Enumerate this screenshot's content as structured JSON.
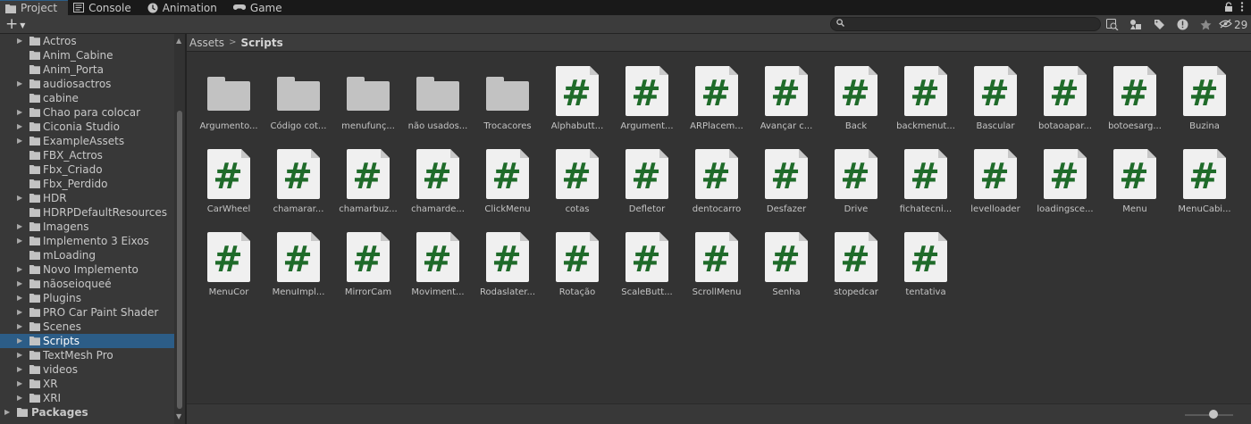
{
  "tabs": [
    {
      "label": "Project",
      "icon": "folder-icon",
      "active": true
    },
    {
      "label": "Console",
      "icon": "console-icon",
      "active": false
    },
    {
      "label": "Animation",
      "icon": "animation-icon",
      "active": false
    },
    {
      "label": "Game",
      "icon": "game-icon",
      "active": false
    }
  ],
  "toolbar": {
    "add_label": "+",
    "search_value": "",
    "search_placeholder": "",
    "hidden_count": "29"
  },
  "tree": {
    "items": [
      {
        "label": "Actros",
        "expandable": true
      },
      {
        "label": "Anim_Cabine",
        "expandable": false
      },
      {
        "label": "Anim_Porta",
        "expandable": false
      },
      {
        "label": "audiosactros",
        "expandable": true
      },
      {
        "label": "cabine",
        "expandable": false
      },
      {
        "label": "Chao para colocar",
        "expandable": true
      },
      {
        "label": "Ciconia Studio",
        "expandable": true
      },
      {
        "label": "ExampleAssets",
        "expandable": true
      },
      {
        "label": "FBX_Actros",
        "expandable": false
      },
      {
        "label": "Fbx_Criado",
        "expandable": false
      },
      {
        "label": "Fbx_Perdido",
        "expandable": false
      },
      {
        "label": "HDR",
        "expandable": true
      },
      {
        "label": "HDRPDefaultResources",
        "expandable": false
      },
      {
        "label": "Imagens",
        "expandable": true
      },
      {
        "label": "Implemento 3 Eixos",
        "expandable": true
      },
      {
        "label": "mLoading",
        "expandable": false
      },
      {
        "label": "Novo Implemento",
        "expandable": true
      },
      {
        "label": "nãoseioqueé",
        "expandable": true
      },
      {
        "label": "Plugins",
        "expandable": true
      },
      {
        "label": "PRO Car Paint Shader",
        "expandable": true
      },
      {
        "label": "Scenes",
        "expandable": true
      },
      {
        "label": "Scripts",
        "expandable": true,
        "selected": true
      },
      {
        "label": "TextMesh Pro",
        "expandable": true
      },
      {
        "label": "videos",
        "expandable": true
      },
      {
        "label": "XR",
        "expandable": true
      },
      {
        "label": "XRI",
        "expandable": true
      }
    ],
    "root": {
      "label": "Packages"
    }
  },
  "breadcrumb": {
    "root": "Assets",
    "current": "Scripts"
  },
  "assets": [
    {
      "name": "Argumento...",
      "type": "folder"
    },
    {
      "name": "Código cot...",
      "type": "folder"
    },
    {
      "name": "menufunç...",
      "type": "folder"
    },
    {
      "name": "não usados...",
      "type": "folder"
    },
    {
      "name": "Trocacores",
      "type": "folder"
    },
    {
      "name": "Alphabutt...",
      "type": "script"
    },
    {
      "name": "Argument...",
      "type": "script"
    },
    {
      "name": "ARPlacem...",
      "type": "script"
    },
    {
      "name": "Avançar c...",
      "type": "script"
    },
    {
      "name": "Back",
      "type": "script"
    },
    {
      "name": "backmenut...",
      "type": "script"
    },
    {
      "name": "Bascular",
      "type": "script"
    },
    {
      "name": "botaoapar...",
      "type": "script"
    },
    {
      "name": "botoesarg...",
      "type": "script"
    },
    {
      "name": "Buzina",
      "type": "script"
    },
    {
      "name": "CarWheel",
      "type": "script"
    },
    {
      "name": "chamarar...",
      "type": "script"
    },
    {
      "name": "chamarbuz...",
      "type": "script"
    },
    {
      "name": "chamarde...",
      "type": "script"
    },
    {
      "name": "ClickMenu",
      "type": "script"
    },
    {
      "name": "cotas",
      "type": "script"
    },
    {
      "name": "Defletor",
      "type": "script"
    },
    {
      "name": "dentocarro",
      "type": "script"
    },
    {
      "name": "Desfazer",
      "type": "script"
    },
    {
      "name": "Drive",
      "type": "script"
    },
    {
      "name": "fichatecni...",
      "type": "script"
    },
    {
      "name": "levelloader",
      "type": "script"
    },
    {
      "name": "loadingsce...",
      "type": "script"
    },
    {
      "name": "Menu",
      "type": "script"
    },
    {
      "name": "MenuCabi...",
      "type": "script"
    },
    {
      "name": "MenuCor",
      "type": "script"
    },
    {
      "name": "MenuImpl...",
      "type": "script"
    },
    {
      "name": "MirrorCam",
      "type": "script"
    },
    {
      "name": "Moviment...",
      "type": "script"
    },
    {
      "name": "Rodaslater...",
      "type": "script"
    },
    {
      "name": "Rotação",
      "type": "script"
    },
    {
      "name": "ScaleButt...",
      "type": "script"
    },
    {
      "name": "ScrollMenu",
      "type": "script"
    },
    {
      "name": "Senha",
      "type": "script"
    },
    {
      "name": "stopedcar",
      "type": "script"
    },
    {
      "name": "tentativa",
      "type": "script"
    }
  ],
  "script_glyph": "#",
  "colors": {
    "selection": "#2c5d87",
    "script_hash": "#1f6b2a",
    "script_page": "#f0f0f0",
    "folder": "#c2c2c2"
  }
}
